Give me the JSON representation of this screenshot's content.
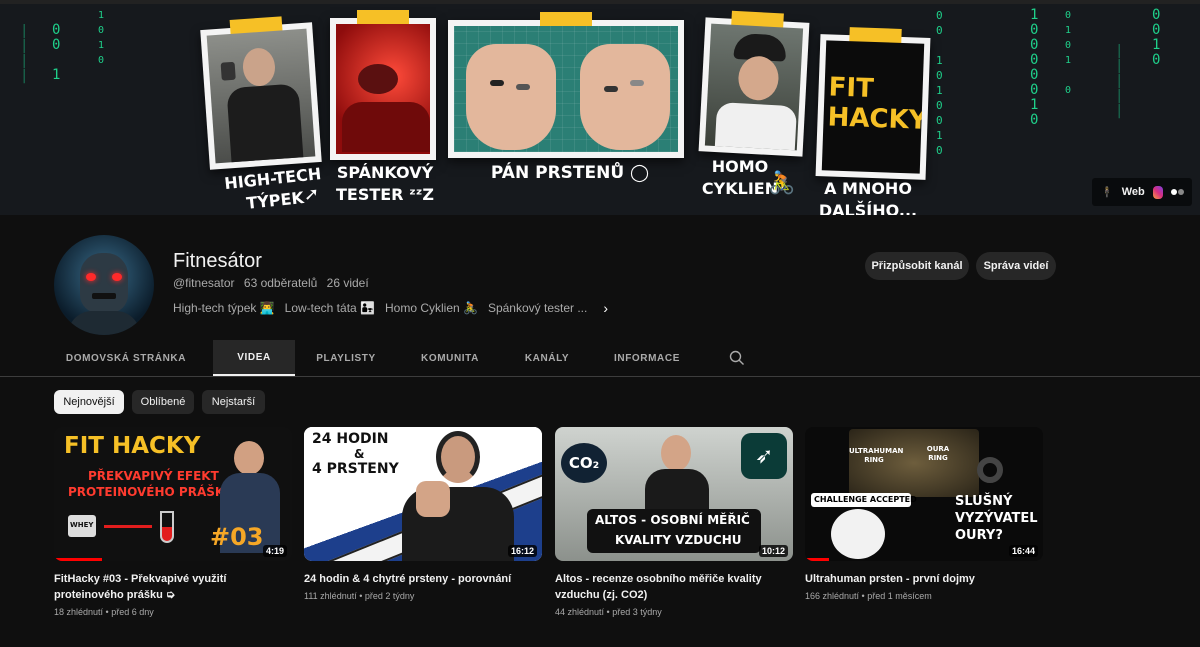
{
  "banner": {
    "captions": [
      "HIGH-TECH\nTÝPEK",
      "SPÁNKOVÝ\nTESTER ᶻᶻZ",
      "PÁN PRSTENŮ ◯",
      "HOMO\nCYKLIEN",
      "A MNOHO\nDALŠÍHO..."
    ],
    "fit_hacky_card": "FIT\nHACKY",
    "links": {
      "web": "Web"
    }
  },
  "channel": {
    "name": "Fitnesátor",
    "handle": "@fitnesator",
    "subscribers": "63 odběratelů",
    "videos": "26 videí",
    "description": [
      "High-tech týpek 👨‍💻",
      "Low-tech táta 👨‍👧",
      "Homo Cyklien 🚴",
      "Spánkový tester ..."
    ],
    "customize_button": "Přizpůsobit kanál",
    "manage_button": "Správa videí"
  },
  "tabs": [
    "DOMOVSKÁ STRÁNKA",
    "VIDEA",
    "PLAYLISTY",
    "KOMUNITA",
    "KANÁLY",
    "INFORMACE"
  ],
  "active_tab": "VIDEA",
  "chips": [
    "Nejnovější",
    "Oblíbené",
    "Nejstarší"
  ],
  "videos": [
    {
      "title": "FitHacky #03 - Překvapivé využití proteinového prášku ➭",
      "views": "18 zhlédnutí",
      "age": "před 6 dny",
      "duration": "4:19",
      "thumb_text": [
        "FIT HACKY",
        "PŘEKVAPIVÝ EFEKT",
        "PROTEINOVÉHO PRÁŠKU",
        "#03",
        "WHEY"
      ],
      "watched": 0.2
    },
    {
      "title": "24 hodin & 4 chytré prsteny - porovnání",
      "views": "111 zhlédnutí",
      "age": "před 2 týdny",
      "duration": "16:12",
      "thumb_text": [
        "24 HODIN",
        "&",
        "4 PRSTENY"
      ],
      "watched": 0
    },
    {
      "title": "Altos - recenze osobního měřiče kvality vzduchu (zj. CO2)",
      "views": "44 zhlédnutí",
      "age": "před 3 týdny",
      "duration": "10:12",
      "thumb_text": [
        "CO₂",
        "ALTOS - OSOBNÍ MĚŘIČ",
        "KVALITY VZDUCHU"
      ],
      "watched": 0
    },
    {
      "title": "Ultrahuman prsten - první dojmy",
      "views": "166 zhlédnutí",
      "age": "před 1 měsícem",
      "duration": "16:44",
      "thumb_text": [
        "ULTRAHUMAN\nRING",
        "OURA\nRING",
        "CHALLENGE ACCEPTED",
        "SLUŠNÝ\nVYZÝVATEL\nOURY?"
      ],
      "watched": 0.1
    }
  ],
  "colors": {
    "accent": "#f6c026",
    "matrix": "#1fcf8a",
    "background": "#0f0f0f",
    "progress": "#ff0000"
  }
}
